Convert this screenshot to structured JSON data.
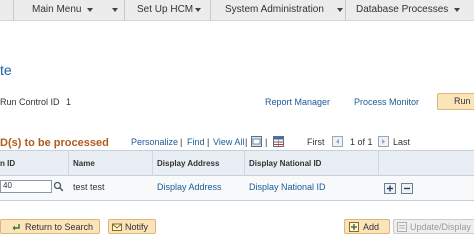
{
  "menubar": {
    "items": [
      {
        "label": "Main Menu"
      },
      {
        "label": "Set Up HCM"
      },
      {
        "label": "System Administration"
      },
      {
        "label": "Database Processes"
      }
    ]
  },
  "page": {
    "title_fragment": "te"
  },
  "run_control": {
    "label": "Run Control ID",
    "value": "1",
    "report_manager": "Report Manager",
    "process_monitor": "Process Monitor",
    "run_button": "Run"
  },
  "grid": {
    "title": "D(s) to be processed",
    "personalize": "Personalize",
    "find": "Find",
    "view_all": "View All",
    "sep": "|",
    "first": "First",
    "range": "1 of 1",
    "last": "Last",
    "columns": [
      "n ID",
      "Name",
      "Display Address",
      "Display National ID"
    ],
    "row": {
      "id_value": "40",
      "name": "test test",
      "display_address": "Display Address",
      "display_national_id": "Display National ID"
    }
  },
  "footer": {
    "return_to_search": "Return to Search",
    "notify": "Notify",
    "add": "Add",
    "update_display": "Update/Display"
  },
  "colors": {
    "link": "#1a5b98",
    "grid_title": "#b05a1c",
    "button_bg": "#fbe3ba"
  }
}
